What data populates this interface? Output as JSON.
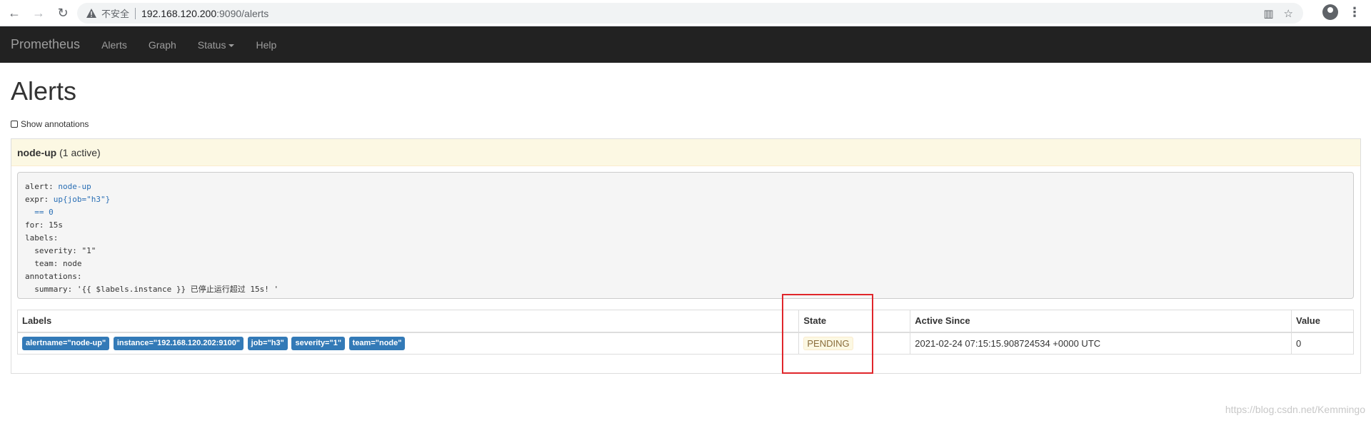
{
  "browser": {
    "back_icon": "arrow-left-icon",
    "forward_icon": "arrow-right-icon",
    "reload_icon": "reload-icon",
    "insecure_label": "不安全",
    "url_host": "192.168.120.200",
    "url_rest": ":9090/alerts"
  },
  "navbar": {
    "brand": "Prometheus",
    "links": [
      "Alerts",
      "Graph",
      "Status",
      "Help"
    ]
  },
  "page": {
    "title": "Alerts",
    "show_annotations": "Show annotations",
    "show_annotations_checked": false
  },
  "rule": {
    "name": "node-up",
    "active_text": "(1 active)",
    "definition": [
      {
        "indent": "",
        "key": "alert:",
        "val": " node-up"
      },
      {
        "indent": "",
        "key": "expr:",
        "val": " up{job=\"h3\"}"
      },
      {
        "indent": "  ",
        "key": "",
        "val": "== 0"
      },
      {
        "indent": "",
        "key": "for: 15s",
        "val": ""
      },
      {
        "indent": "",
        "key": "labels:",
        "val": ""
      },
      {
        "indent": "  ",
        "key": "severity: \"1\"",
        "val": ""
      },
      {
        "indent": "  ",
        "key": "team: node",
        "val": ""
      },
      {
        "indent": "",
        "key": "annotations:",
        "val": ""
      },
      {
        "indent": "  ",
        "key": "summary: '{{ $labels.instance }} 已停止运行超过 15s! '",
        "val": ""
      }
    ]
  },
  "table": {
    "headers": [
      "Labels",
      "State",
      "Active Since",
      "Value"
    ],
    "rows": [
      {
        "labels": [
          "alertname=\"node-up\"",
          "instance=\"192.168.120.202:9100\"",
          "job=\"h3\"",
          "severity=\"1\"",
          "team=\"node\""
        ],
        "state": "PENDING",
        "active_since": "2021-02-24 07:15:15.908724534 +0000 UTC",
        "value": "0"
      }
    ]
  },
  "watermark": "https://blog.csdn.net/Kemmingo"
}
